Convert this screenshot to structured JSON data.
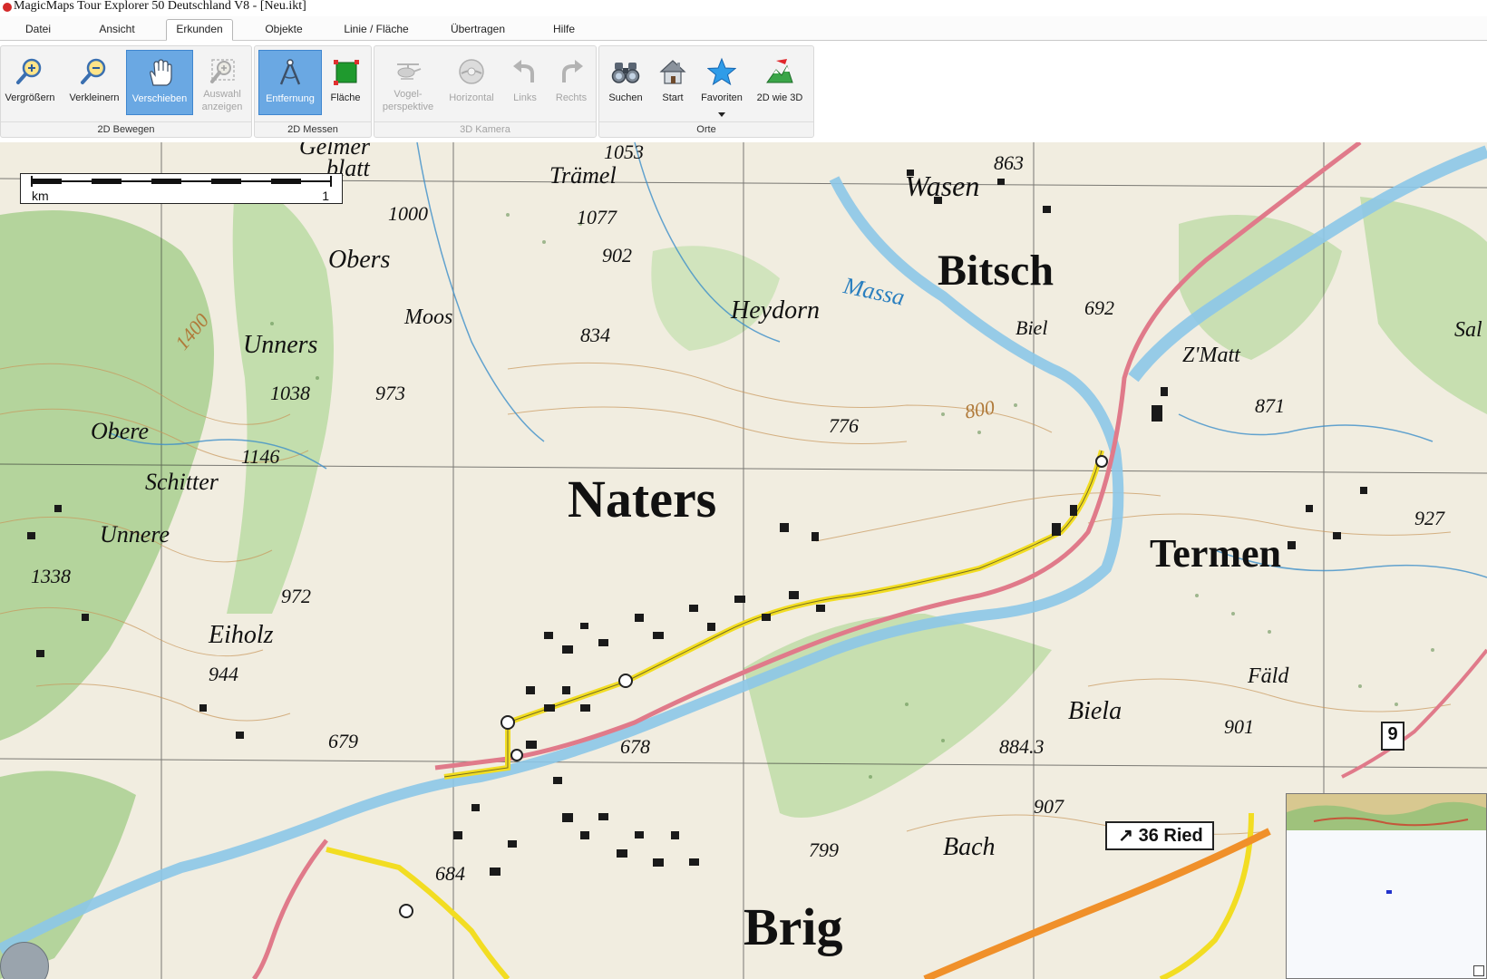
{
  "window": {
    "title": "MagicMaps Tour Explorer 50 Deutschland V8 - [Neu.ikt]"
  },
  "menu": {
    "tabs": [
      {
        "label": "Datei"
      },
      {
        "label": "Ansicht"
      },
      {
        "label": "Erkunden"
      },
      {
        "label": "Objekte"
      },
      {
        "label": "Linie / Fläche"
      },
      {
        "label": "Übertragen"
      },
      {
        "label": "Hilfe"
      }
    ],
    "active_tab": "Erkunden"
  },
  "ribbon": {
    "groups": [
      {
        "label": "2D Bewegen",
        "buttons": [
          {
            "label": "Vergrößern",
            "icon": "zoom-in-icon"
          },
          {
            "label": "Verkleinern",
            "icon": "zoom-out-icon"
          },
          {
            "label": "Verschieben",
            "icon": "hand-icon",
            "active": true
          },
          {
            "label_line1": "Auswahl",
            "label_line2": "anzeigen",
            "icon": "zoom-selection-icon",
            "disabled": true
          }
        ]
      },
      {
        "label": "2D Messen",
        "buttons": [
          {
            "label": "Entfernung",
            "icon": "compass-icon",
            "active": true
          },
          {
            "label": "Fläche",
            "icon": "area-icon"
          }
        ]
      },
      {
        "label": "3D Kamera",
        "disabled": true,
        "buttons": [
          {
            "label_line1": "Vogel-",
            "label_line2": "perspektive",
            "icon": "helicopter-icon"
          },
          {
            "label": "Horizontal",
            "icon": "horizontal-icon"
          },
          {
            "label": "Links",
            "icon": "rotate-left-icon"
          },
          {
            "label": "Rechts",
            "icon": "rotate-right-icon"
          }
        ]
      },
      {
        "label": "Orte",
        "buttons": [
          {
            "label": "Suchen",
            "icon": "binoculars-icon"
          },
          {
            "label": "Start",
            "icon": "home-icon"
          },
          {
            "label": "Favoriten",
            "icon": "star-icon"
          },
          {
            "label": "2D wie 3D",
            "icon": "2d-like-3d-icon"
          }
        ]
      }
    ]
  },
  "map": {
    "scale": {
      "unit": "km",
      "value": "1"
    },
    "places": [
      "Naters",
      "Bitsch",
      "Termen",
      "Brig",
      "Heydorn",
      "Wasen",
      "Trämel",
      "Obers",
      "Moos",
      "Unners",
      "Obere",
      "Schitter",
      "Unnere",
      "Eiholz",
      "Biela",
      "Fäld",
      "Bach",
      "Biel",
      "Z'Matt",
      "Massa",
      "Gelmer",
      "blatt",
      "Sal"
    ],
    "elevations": [
      "1053",
      "1077",
      "1000",
      "902",
      "863",
      "834",
      "692",
      "1038",
      "973",
      "776",
      "871",
      "927",
      "1146",
      "1338",
      "972",
      "944",
      "679",
      "678",
      "884.3",
      "901",
      "907",
      "799",
      "684",
      "1400",
      "800"
    ],
    "road_sign": "36 Ried",
    "route_number": "9"
  },
  "colors": {
    "accent_blue": "#6aa8e3",
    "forest_green": "#8fc27a",
    "river_blue": "#8cc7e8",
    "rail_red": "#e07a8a",
    "road_yellow": "#f2dd22",
    "motorway_orange": "#f0902a"
  }
}
